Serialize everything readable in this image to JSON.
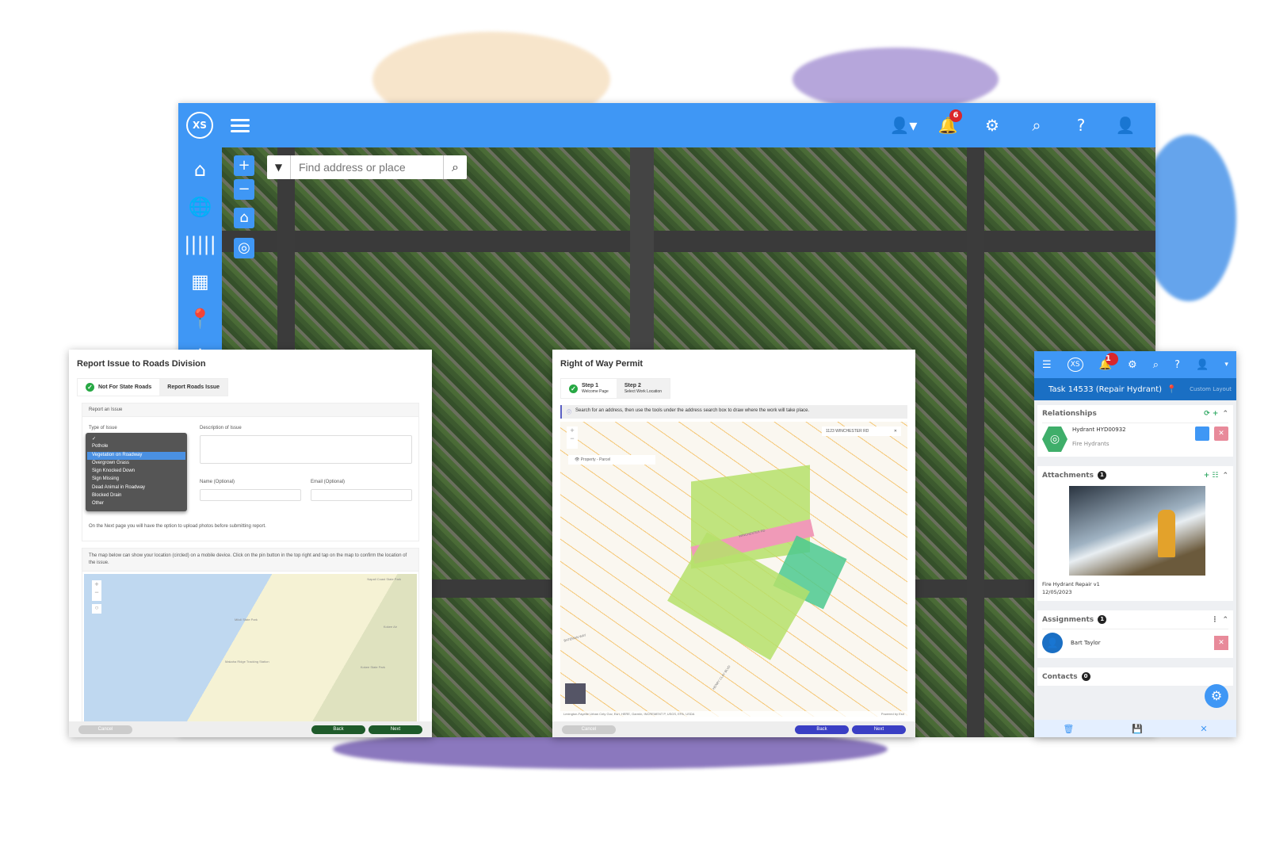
{
  "main_app": {
    "logo": "XS",
    "topbar_icons": [
      "user-switch-icon",
      "bell-icon",
      "gear-icon",
      "search-icon",
      "help-icon",
      "user-icon"
    ],
    "notification_count": "6",
    "sidebar_icons": [
      "home-icon",
      "globe-icon",
      "barcode-icon",
      "cubes-icon",
      "map-pin-icon",
      "gear-icon"
    ],
    "search_placeholder": "Find address or place",
    "map_controls": [
      "+",
      "−",
      "⌂",
      "◎"
    ]
  },
  "report_panel": {
    "title": "Report Issue to Roads Division",
    "steps": [
      "Not For State Roads",
      "Report Roads Issue"
    ],
    "section_title": "Report an Issue",
    "type_label": "Type of Issue",
    "description_label": "Description of Issue",
    "name_label": "Name (Optional)",
    "email_label": "Email (Optional)",
    "dropdown_options": [
      "✓",
      "Pothole",
      "Vegetation on Roadway",
      "Overgrown Grass",
      "Sign Knocked Down",
      "Sign Missing",
      "Dead Animal in Roadway",
      "Blocked Drain",
      "Other"
    ],
    "selected_option": "Vegetation on Roadway",
    "upload_note": "On the Next page you will have the option to upload photos before submitting report.",
    "map_note": "The map below can show your location (circled) on a mobile device. Click on the pin button in the top right and tap on the map to confirm the location of the issue.",
    "map_labels": [
      "Napali Coast State Park",
      "Miloli State Park",
      "Kokee Air",
      "Makaha Ridge Tracking Station",
      "Kokee State Park"
    ],
    "buttons": {
      "cancel": "Cancel",
      "back": "Back",
      "next": "Next"
    },
    "button_color": "#1e5a2a"
  },
  "permit_panel": {
    "title": "Right of Way Permit",
    "steps": [
      {
        "title": "Step 1",
        "subtitle": "Welcome Page"
      },
      {
        "title": "Step 2",
        "subtitle": "Select Work Location"
      }
    ],
    "info": "Search for an address, then use the tools under the address search box to draw where the work will take place.",
    "map_search": "1123 WINCHESTER RD",
    "layer_label": "Property - Parcel",
    "street_labels": [
      "WINCHESTER RD",
      "HENRY CLAY BLVD",
      "BATEMAN WAY"
    ],
    "attribution": "Lexington-Fayette Urban Cnty Gov, Esri, HERE, Garmin, INCREMENT P, USGS, EPA, USDA",
    "powered_by": "Powered by Esri",
    "buttons": {
      "cancel": "Cancel",
      "back": "Back",
      "next": "Next"
    },
    "button_color": "#3a3fc4"
  },
  "task_panel": {
    "logo": "XS",
    "notification_count": "1",
    "task_title": "Task 14533 (Repair Hydrant)",
    "custom_layout": "Custom Layout",
    "relationships": {
      "label": "Relationships",
      "item_title": "Hydrant HYD00932",
      "item_subtitle": "Fire Hydrants"
    },
    "attachments": {
      "label": "Attachments",
      "count": "1",
      "caption": "Fire Hydrant Repair v1",
      "date": "12/05/2023"
    },
    "assignments": {
      "label": "Assignments",
      "count": "1",
      "person": "Bart Taylor"
    },
    "contacts": {
      "label": "Contacts",
      "count": "0"
    },
    "footer_icons": [
      "trash-icon",
      "save-icon",
      "close-icon"
    ]
  }
}
